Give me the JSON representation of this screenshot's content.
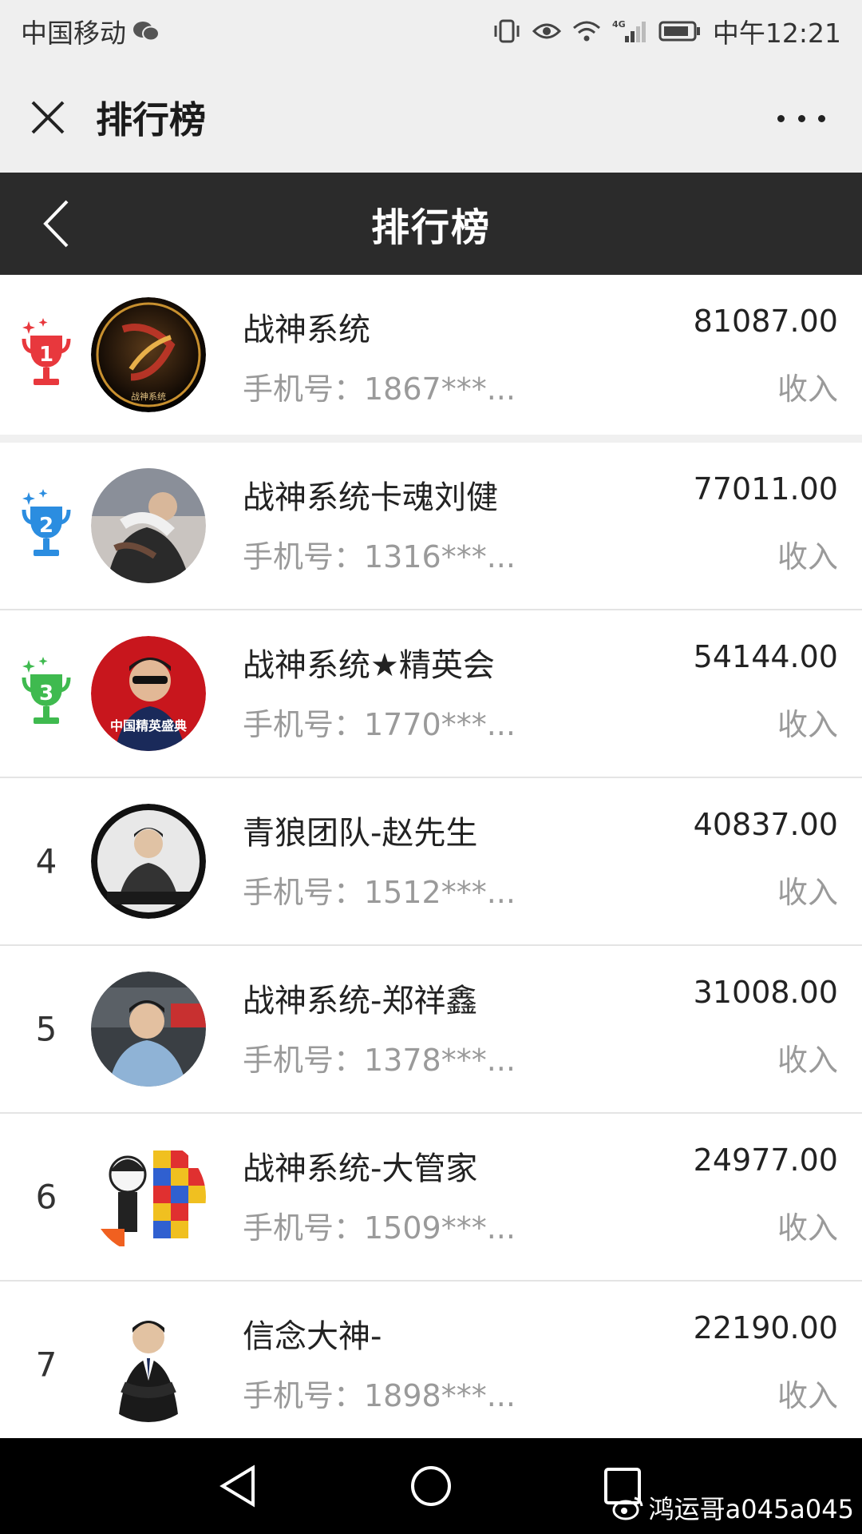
{
  "status_bar": {
    "carrier": "中国移动",
    "network": "4G",
    "time": "中午12:21"
  },
  "wechat_bar": {
    "title": "排行榜"
  },
  "header": {
    "title": "排行榜"
  },
  "colors": {
    "rank1": "#e8383d",
    "rank2": "#2b8de0",
    "rank3": "#3fba4f",
    "header_bg": "#2b2b2b"
  },
  "rankings": [
    {
      "rank": "1",
      "name": "战神系统",
      "phone": "手机号：1867***...",
      "amount": "81087.00",
      "label": "收入"
    },
    {
      "rank": "2",
      "name": "战神系统卡魂刘健",
      "phone": "手机号：1316***...",
      "amount": "77011.00",
      "label": "收入"
    },
    {
      "rank": "3",
      "name": "战神系统★精英会",
      "phone": "手机号：1770***...",
      "amount": "54144.00",
      "label": "收入"
    },
    {
      "rank": "4",
      "name": "青狼团队-赵先生",
      "phone": "手机号：1512***...",
      "amount": "40837.00",
      "label": "收入"
    },
    {
      "rank": "5",
      "name": "战神系统-郑祥鑫",
      "phone": "手机号：1378***...",
      "amount": "31008.00",
      "label": "收入"
    },
    {
      "rank": "6",
      "name": "战神系统-大管家",
      "phone": "手机号：1509***...",
      "amount": "24977.00",
      "label": "收入"
    },
    {
      "rank": "7",
      "name": "信念大神-",
      "phone": "手机号：1898***...",
      "amount": "22190.00",
      "label": "收入"
    }
  ],
  "avatar_texts": {
    "a1": "战神系统",
    "a3": "中国精英盛典"
  },
  "watermark": "鸿运哥a045a045"
}
